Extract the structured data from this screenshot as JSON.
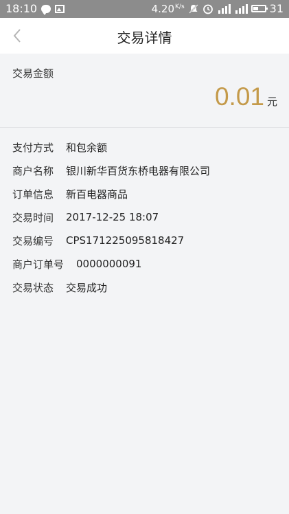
{
  "status_bar": {
    "time": "18:10",
    "speed": "4.20",
    "speed_unit": "K/s",
    "battery": "31",
    "icons": [
      "chat-bubble-icon",
      "image-icon",
      "mute-icon",
      "alarm-icon",
      "signal-icon",
      "signal-4g-icon",
      "battery-icon"
    ]
  },
  "header": {
    "title": "交易详情",
    "back_icon": "chevron-left-icon"
  },
  "amount": {
    "label": "交易金额",
    "value": "0.01",
    "unit": "元",
    "color": "#c49a4a"
  },
  "details": [
    {
      "label": "支付方式",
      "value": "和包余额"
    },
    {
      "label": "商户名称",
      "value": "银川新华百货东桥电器有限公司"
    },
    {
      "label": "订单信息",
      "value": "新百电器商品"
    },
    {
      "label": "交易时间",
      "value": "2017-12-25 18:07"
    },
    {
      "label": "交易编号",
      "value": "CPS171225095818427"
    },
    {
      "label": "商户订单号",
      "value": "0000000091"
    },
    {
      "label": "交易状态",
      "value": "交易成功"
    }
  ]
}
